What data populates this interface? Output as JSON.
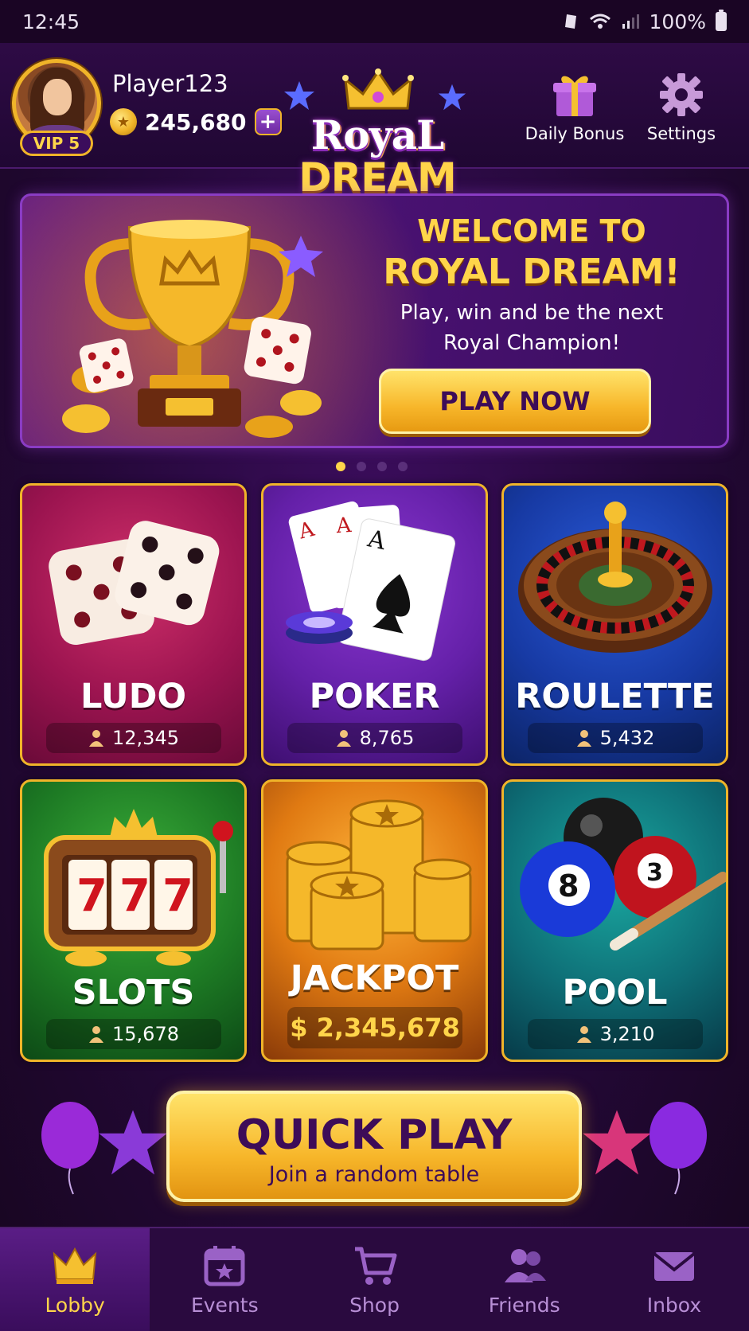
{
  "status_bar": {
    "time": "12:45",
    "battery": "100%",
    "icons": [
      "vibrate-icon",
      "wifi-icon",
      "signal-icon",
      "battery-icon"
    ]
  },
  "header": {
    "player_name": "Player123",
    "vip_label": "VIP 5",
    "coins": "245,680",
    "add_coins_label": "+",
    "logo_line1": "RoyaL",
    "logo_line2": "DREAM",
    "daily_bonus_label": "Daily Bonus",
    "settings_label": "Settings"
  },
  "banner": {
    "title_line1": "WELCOME TO",
    "title_line2": "ROYAL DREAM!",
    "subtitle_line1": "Play, win and be the next",
    "subtitle_line2": "Royal Champion!",
    "cta_label": "PLAY NOW",
    "page_count": 4,
    "active_page": 1
  },
  "games": [
    {
      "title": "LUDO",
      "players": "12,345"
    },
    {
      "title": "POKER",
      "players": "8,765"
    },
    {
      "title": "ROULETTE",
      "players": "5,432"
    },
    {
      "title": "SLOTS",
      "players": "15,678"
    },
    {
      "title": "JACKPOT",
      "amount": "$ 2,345,678"
    },
    {
      "title": "POOL",
      "players": "3,210"
    }
  ],
  "quick_play": {
    "title": "QUICK PLAY",
    "subtitle": "Join a random table"
  },
  "bottom_nav": [
    {
      "label": "Lobby",
      "icon": "crown-icon",
      "active": true
    },
    {
      "label": "Events",
      "icon": "calendar-star-icon",
      "active": false
    },
    {
      "label": "Shop",
      "icon": "cart-icon",
      "active": false
    },
    {
      "label": "Friends",
      "icon": "friends-icon",
      "active": false
    },
    {
      "label": "Inbox",
      "icon": "mail-icon",
      "active": false
    }
  ],
  "colors": {
    "accent_gold": "#f0b429",
    "text_gold": "#ffd54a",
    "primary_purple": "#3d0c58",
    "nav_inactive": "#b88fd6"
  }
}
